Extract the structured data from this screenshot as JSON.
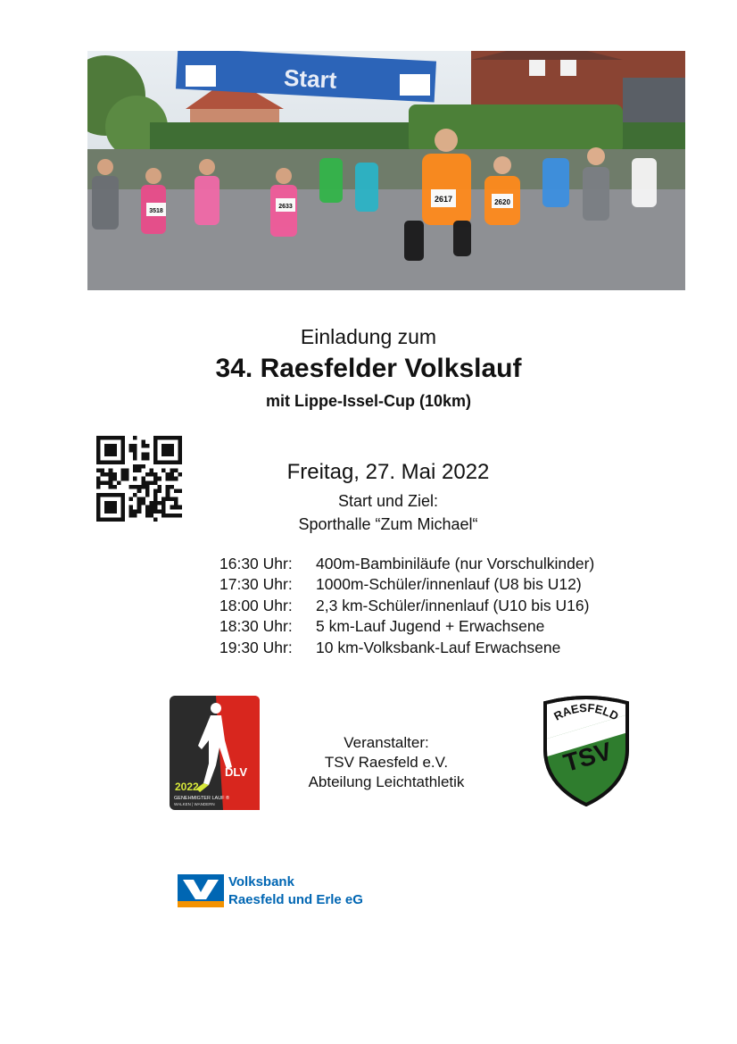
{
  "photo": {
    "banner_text": "Start",
    "bibs": [
      "2617",
      "2620",
      "2633",
      "3518"
    ]
  },
  "header": {
    "invitation": "Einladung zum",
    "title": "34. Raesfelder Volkslauf",
    "subtitle": "mit Lippe-Issel-Cup (10km)"
  },
  "event": {
    "date": "Freitag, 27. Mai 2022",
    "start_finish_label": "Start und Ziel:",
    "venue": "Sporthalle “Zum Michael“"
  },
  "schedule": [
    {
      "time": "16:30 Uhr:",
      "race": "400m-Bambiniläufe (nur Vorschulkinder)"
    },
    {
      "time": "17:30 Uhr:",
      "race": "1000m-Schüler/innenlauf (U8 bis U12)"
    },
    {
      "time": "18:00 Uhr:",
      "race": "2,3 km-Schüler/innenlauf (U10 bis U16)"
    },
    {
      "time": "18:30 Uhr:",
      "race": "5 km-Lauf Jugend + Erwachsene"
    },
    {
      "time": "19:30 Uhr:",
      "race": "10 km-Volksbank-Lauf Erwachsene"
    }
  ],
  "organizer": {
    "label": "Veranstalter:",
    "club": "TSV Raesfeld e.V.",
    "department": "Abteilung Leichtathletik"
  },
  "dlv_logo": {
    "year": "2022",
    "brand": "DLV",
    "line1": "GENEHMIGTER LAUF ®",
    "line2": "WALKEN | WANDERN"
  },
  "tsv_logo": {
    "arc": "RAESFELD",
    "text": "TSV"
  },
  "sponsor": {
    "line1": "Volksbank",
    "line2": "Raesfeld und Erle eG"
  },
  "colors": {
    "banner_blue": "#2c64b8",
    "tsv_green": "#2f7d2e",
    "dlv_red": "#d8261e",
    "volksbank_blue": "#0066b3",
    "volksbank_orange": "#f39200"
  }
}
